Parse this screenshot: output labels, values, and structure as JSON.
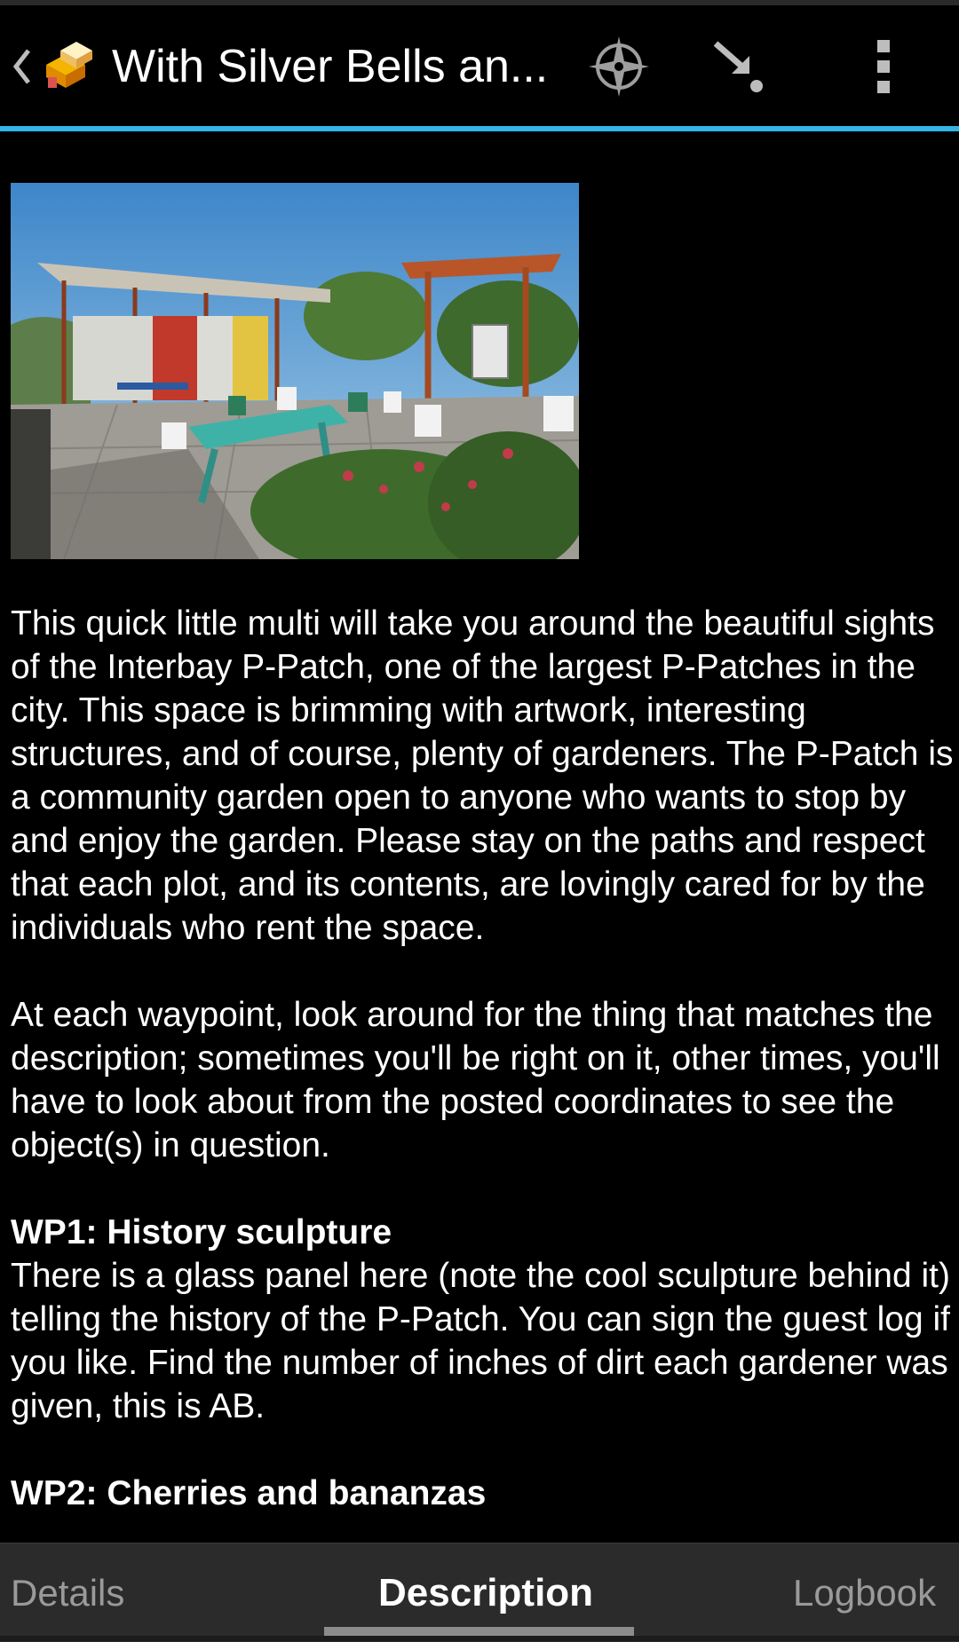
{
  "action_bar": {
    "title": "With Silver Bells an...",
    "icons": [
      "back-chevron-icon",
      "geocache-logo-icon",
      "compass-icon",
      "navigate-icon",
      "overflow-menu-icon"
    ],
    "accent_color": "#33b5e5"
  },
  "description": {
    "paragraphs": [
      "This quick little multi will take you around the beautiful sights of the Interbay P-Patch, one of the largest P-Patches in the city. This space is brimming with artwork, interesting structures, and of course, plenty of gardeners. The P-Patch is a community garden open to anyone who wants to stop by and enjoy the garden. Please stay on the paths and respect that each plot, and its contents, are lovingly cared for by the individuals who rent the space.",
      "At each waypoint, look around for the thing that matches the description; sometimes you'll be right on it, other times, you'll have to look about from the posted coordinates to see the object(s) in question."
    ],
    "wp1_heading": "WP1: History sculpture",
    "wp1_text": "There is a glass panel here (note the cool sculpture behind it) telling the history of the P-Patch. You can sign the guest log if you like. Find the number of inches of dirt each gardener was given, this is AB.",
    "wp2_heading": "WP2: Cherries and bananzas"
  },
  "tabs": {
    "details": "Details",
    "description": "Description",
    "logbook": "Logbook",
    "active": "Description"
  }
}
